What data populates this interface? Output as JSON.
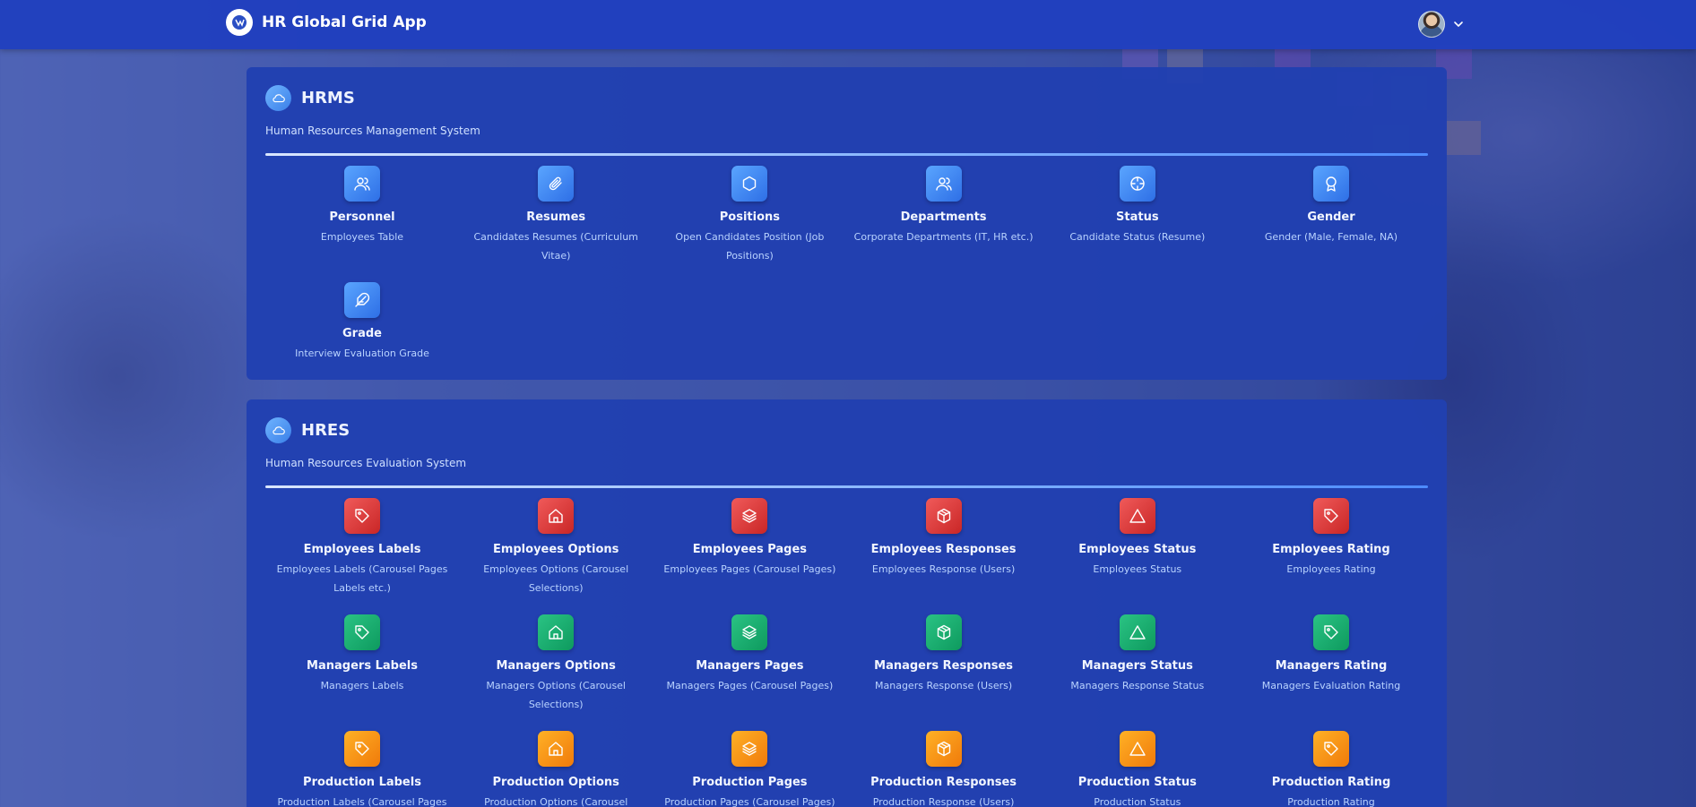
{
  "app": {
    "title": "HR Global Grid App"
  },
  "sections": [
    {
      "title": "HRMS",
      "subtitle": "Human Resources Management System",
      "tiles": [
        {
          "label": "Personnel",
          "desc": "Employees Table",
          "icon": "users-icon",
          "color": "blue"
        },
        {
          "label": "Resumes",
          "desc": "Candidates Resumes (Curriculum Vitae)",
          "icon": "paperclip-icon",
          "color": "blue"
        },
        {
          "label": "Positions",
          "desc": "Open Candidates Position (Job Positions)",
          "icon": "hexagon-icon",
          "color": "blue"
        },
        {
          "label": "Departments",
          "desc": "Corporate Departments (IT, HR etc.)",
          "icon": "users-icon",
          "color": "blue"
        },
        {
          "label": "Status",
          "desc": "Candidate Status (Resume)",
          "icon": "crosshair-icon",
          "color": "blue"
        },
        {
          "label": "Gender",
          "desc": "Gender (Male, Female, NA)",
          "icon": "award-icon",
          "color": "blue"
        },
        {
          "label": "Grade",
          "desc": "Interview Evaluation Grade",
          "icon": "feather-icon",
          "color": "blue"
        }
      ]
    },
    {
      "title": "HRES",
      "subtitle": "Human Resources Evaluation System",
      "tiles": [
        {
          "label": "Employees Labels",
          "desc": "Employees Labels (Carousel Pages Labels etc.)",
          "icon": "tag-icon",
          "color": "red"
        },
        {
          "label": "Employees Options",
          "desc": "Employees Options (Carousel Selections)",
          "icon": "home-icon",
          "color": "red"
        },
        {
          "label": "Employees Pages",
          "desc": "Employees Pages (Carousel Pages)",
          "icon": "layers-icon",
          "color": "red"
        },
        {
          "label": "Employees Responses",
          "desc": "Employees Response (Users)",
          "icon": "package-icon",
          "color": "red"
        },
        {
          "label": "Employees Status",
          "desc": "Employees Status",
          "icon": "triangle-icon",
          "color": "red"
        },
        {
          "label": "Employees Rating",
          "desc": "Employees Rating",
          "icon": "tag-icon",
          "color": "red"
        },
        {
          "label": "Managers Labels",
          "desc": "Managers Labels",
          "icon": "tag-icon",
          "color": "green"
        },
        {
          "label": "Managers Options",
          "desc": "Managers Options (Carousel Selections)",
          "icon": "home-icon",
          "color": "green"
        },
        {
          "label": "Managers Pages",
          "desc": "Managers Pages (Carousel Pages)",
          "icon": "layers-icon",
          "color": "green"
        },
        {
          "label": "Managers Responses",
          "desc": "Managers Response (Users)",
          "icon": "package-icon",
          "color": "green"
        },
        {
          "label": "Managers Status",
          "desc": "Managers Response Status",
          "icon": "triangle-icon",
          "color": "green"
        },
        {
          "label": "Managers Rating",
          "desc": "Managers Evaluation Rating",
          "icon": "tag-icon",
          "color": "green"
        },
        {
          "label": "Production Labels",
          "desc": "Production Labels (Carousel Pages",
          "icon": "tag-icon",
          "color": "orange"
        },
        {
          "label": "Production Options",
          "desc": "Production Options (Carousel",
          "icon": "home-icon",
          "color": "orange"
        },
        {
          "label": "Production Pages",
          "desc": "Production Pages (Carousel Pages)",
          "icon": "layers-icon",
          "color": "orange"
        },
        {
          "label": "Production Responses",
          "desc": "Production Response (Users)",
          "icon": "package-icon",
          "color": "orange"
        },
        {
          "label": "Production Status",
          "desc": "Production Status",
          "icon": "triangle-icon",
          "color": "orange"
        },
        {
          "label": "Production Rating",
          "desc": "Production Rating",
          "icon": "tag-icon",
          "color": "orange"
        }
      ]
    }
  ]
}
